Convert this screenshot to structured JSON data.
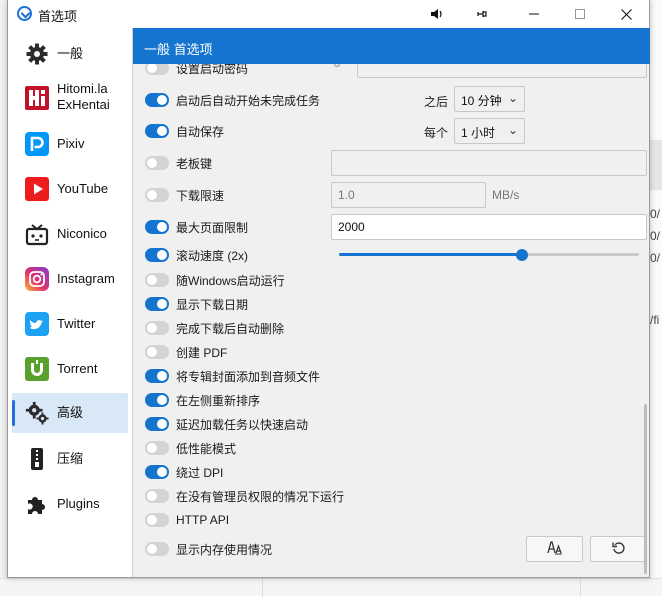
{
  "window": {
    "title": "首选项",
    "header": "一般 首选项"
  },
  "titlebar_icons": [
    "speaker-icon",
    "pin-icon",
    "minimize-icon",
    "maximize-icon",
    "close-icon"
  ],
  "sidebar": {
    "items": [
      {
        "label": "一般",
        "icon": "gear-icon",
        "active": false
      },
      {
        "label": "Hitomi.la\nExHentai",
        "icon": "hitomi-icon",
        "active": false
      },
      {
        "label": "Pixiv",
        "icon": "pixiv-icon",
        "active": false
      },
      {
        "label": "YouTube",
        "icon": "youtube-icon",
        "active": false
      },
      {
        "label": "Niconico",
        "icon": "niconico-icon",
        "active": false
      },
      {
        "label": "Instagram",
        "icon": "instagram-icon",
        "active": false
      },
      {
        "label": "Twitter",
        "icon": "twitter-icon",
        "active": false
      },
      {
        "label": "Torrent",
        "icon": "torrent-icon",
        "active": false
      },
      {
        "label": "高级",
        "icon": "advanced-gear-icon",
        "active": true
      },
      {
        "label": "压缩",
        "icon": "zip-icon",
        "active": false
      },
      {
        "label": "Plugins",
        "icon": "puzzle-icon",
        "active": false
      }
    ]
  },
  "settings": {
    "password": {
      "label": "设置启动密码",
      "on": false
    },
    "auto_start": {
      "label": "启动后自动开始未完成任务",
      "on": true,
      "after_label": "之后",
      "after_value": "10 分钟"
    },
    "auto_save": {
      "label": "自动保存",
      "on": true,
      "every_label": "每个",
      "every_value": "1 小时"
    },
    "boss_key": {
      "label": "老板键",
      "on": false,
      "value": ""
    },
    "speed_limit": {
      "label": "下载限速",
      "on": false,
      "value": "1.0",
      "unit": "MB/s"
    },
    "max_page": {
      "label": "最大页面限制",
      "on": true,
      "value": "2000"
    },
    "scroll_speed": {
      "label": "滚动速度 (2x)",
      "on": true,
      "level": 0.61
    },
    "windows_start": {
      "label": "随Windows启动运行",
      "on": false
    },
    "show_date": {
      "label": "显示下载日期",
      "on": true
    },
    "auto_delete": {
      "label": "完成下载后自动删除",
      "on": false
    },
    "create_pdf": {
      "label": "创建 PDF",
      "on": false
    },
    "album_cover": {
      "label": "将专辑封面添加到音频文件",
      "on": true
    },
    "left_sort": {
      "label": "在左侧重新排序",
      "on": true
    },
    "delay_load": {
      "label": "延迟加载任务以快速启动",
      "on": true
    },
    "low_perf": {
      "label": "低性能模式",
      "on": false
    },
    "bypass_dpi": {
      "label": "绕过 DPI",
      "on": true
    },
    "no_admin": {
      "label": "在没有管理员权限的情况下运行",
      "on": false
    },
    "http_api": {
      "label": "HTTP API",
      "on": false
    },
    "show_memory": {
      "label": "显示内存使用情况",
      "on": false
    }
  },
  "actions": {
    "font_icon": "font-icon",
    "reset_icon": "reset-icon"
  },
  "background_fragments": [
    "0/",
    "0/",
    "0/",
    "/fi"
  ],
  "colors": {
    "accent": "#1674d1",
    "active_bg": "#d9e8f6"
  }
}
